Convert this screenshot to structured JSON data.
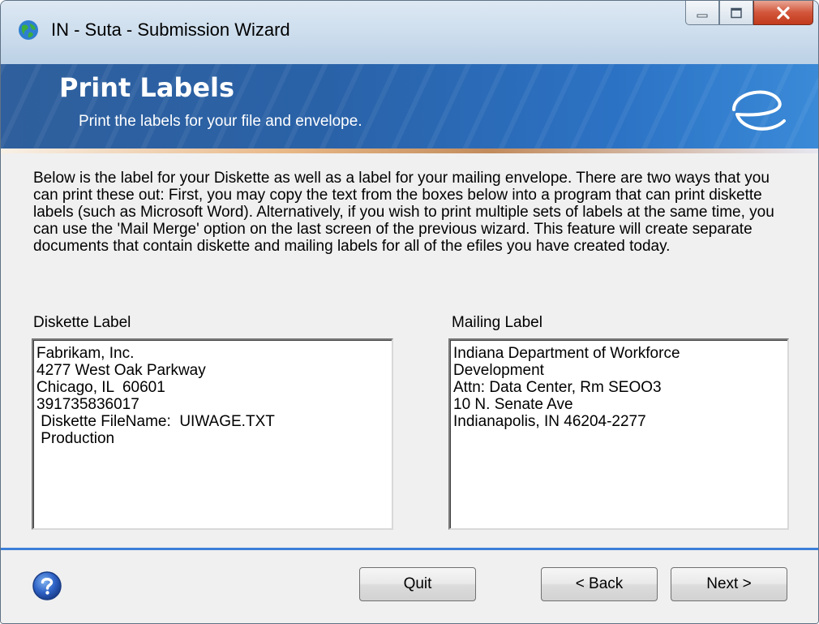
{
  "window": {
    "title": "IN - Suta - Submission Wizard",
    "icons": {
      "app": "globe-icon",
      "minimize": "minimize-icon",
      "maximize": "maximize-icon",
      "close": "close-icon",
      "help": "help-icon",
      "logo": "e-logo-icon"
    }
  },
  "banner": {
    "title": "Print Labels",
    "subtitle": "Print the labels for your file and envelope."
  },
  "content": {
    "description": "Below is the label for your Diskette as well as a label for your mailing envelope.  There are two ways that you can print these out:  First, you may copy the text from the boxes below into a program that can print diskette labels (such as Microsoft Word).  Alternatively, if you wish to print multiple sets of labels at the same time, you can use the 'Mail Merge' option on the last screen of the previous wizard.  This feature will create separate documents that contain diskette and mailing labels for all of the efiles you have created today.",
    "diskette_label": {
      "heading": "Diskette Label",
      "text": "Fabrikam, Inc.\n4277 West Oak Parkway\nChicago, IL  60601\n391735836017\n Diskette FileName:  UIWAGE.TXT\n Production"
    },
    "mailing_label": {
      "heading": "Mailing Label",
      "text": "Indiana Department of Workforce\nDevelopment\nAttn: Data Center, Rm SEOO3\n10 N. Senate Ave\nIndianapolis, IN 46204-2277"
    }
  },
  "buttons": {
    "quit": "Quit",
    "back": "< Back",
    "next": "Next >"
  },
  "colors": {
    "banner": "#2a62a8",
    "separator": "#3c7fd8",
    "close_button": "#c23b1c"
  }
}
